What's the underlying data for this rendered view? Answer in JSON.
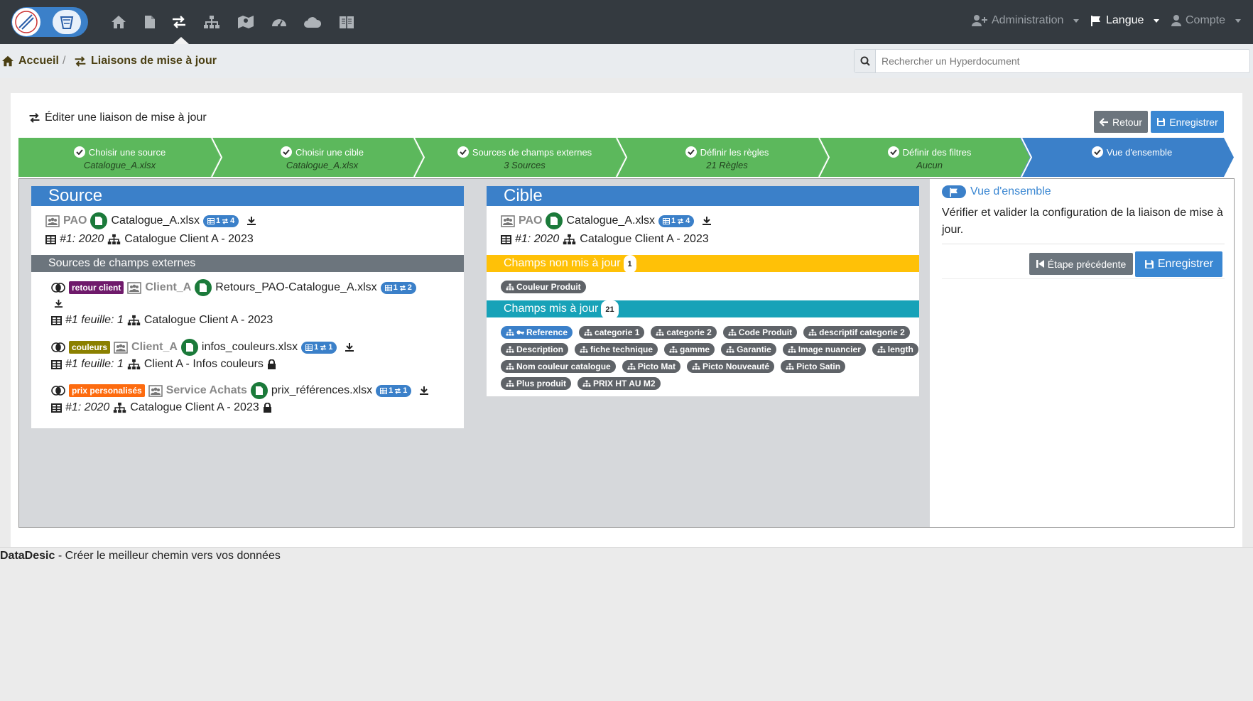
{
  "nav": {
    "active": "liaisons",
    "admin": "Administration",
    "langue": "Langue",
    "compte": "Compte"
  },
  "breadcrumb": {
    "home": "Accueil",
    "current": "Liaisons de mise à jour"
  },
  "search": {
    "placeholder": "Rechercher un Hyperdocument"
  },
  "card": {
    "title": "Éditer une liaison de mise à jour",
    "retour": "Retour",
    "enregistrer": "Enregistrer"
  },
  "steps": [
    {
      "label": "Choisir une source",
      "sub": "Catalogue_A.xlsx"
    },
    {
      "label": "Choisir une cible",
      "sub": "Catalogue_A.xlsx"
    },
    {
      "label": "Sources de champs externes",
      "sub": "3 Sources"
    },
    {
      "label": "Définir les règles",
      "sub": "21 Règles"
    },
    {
      "label": "Définir des filtres",
      "sub": "Aucun"
    },
    {
      "label": "Vue d'ensemble",
      "sub": ""
    }
  ],
  "source": {
    "title": "Source",
    "group": "PAO",
    "file": "Catalogue_A.xlsx",
    "pill_sheets": "1",
    "pill_links": "4",
    "sheet": "#1: 2020",
    "model": "Catalogue Client A - 2023",
    "ext_title": "Sources de champs externes",
    "externals": [
      {
        "tag": "retour client",
        "tag_color": "#6f1a6b",
        "group": "Client_A",
        "file": "Retours_PAO-Catalogue_A.xlsx",
        "pill_sheets": "1",
        "pill_links": "2",
        "sheet": "#1 feuille: 1",
        "model": "Catalogue Client A - 2023"
      },
      {
        "tag": "couleurs",
        "tag_color": "#8b8000",
        "group": "Client_A",
        "file": "infos_couleurs.xlsx",
        "pill_sheets": "1",
        "pill_links": "1",
        "sheet": "#1 feuille: 1",
        "model": "Client A - Infos couleurs"
      },
      {
        "tag": "prix personalisés",
        "tag_color": "#fd6b0f",
        "group": "Service Achats",
        "file": "prix_références.xlsx",
        "pill_sheets": "1",
        "pill_links": "1",
        "sheet": "#1: 2020",
        "model": "Catalogue Client A - 2023"
      }
    ]
  },
  "cible": {
    "title": "Cible",
    "group": "PAO",
    "file": "Catalogue_A.xlsx",
    "pill_sheets": "1",
    "pill_links": "4",
    "sheet": "#1: 2020",
    "model": "Catalogue Client A - 2023",
    "not_updated_title": "Champs non mis à jour",
    "not_updated_count": "1",
    "not_updated": [
      "Couleur Produit"
    ],
    "updated_title": "Champs mis à jour",
    "updated_count": "21",
    "updated": [
      "Reference",
      "categorie 1",
      "categorie 2",
      "Code Produit",
      "descriptif categorie 2",
      "Description",
      "fiche technique",
      "gamme",
      "Garantie",
      "Image nuancier",
      "length",
      "Nom couleur catalogue",
      "Picto Mat",
      "Picto Nouveauté",
      "Picto Satin",
      "Plus produit",
      "PRIX HT AU M2"
    ]
  },
  "overview": {
    "title": "Vue d'ensemble",
    "text": "Vérifier et valider la configuration de la liaison de mise à jour.",
    "prev": "Étape précédente",
    "save": "Enregistrer"
  },
  "footer": {
    "brand": "DataDesic",
    "tagline": " - Créer le meilleur chemin vers vos données"
  },
  "colors": {
    "navbar": "#343a40",
    "primary": "#3b80c9",
    "step_done": "#5cb85c",
    "warning": "#ffc107",
    "info": "#17a2b8",
    "secondary": "#6c757d"
  }
}
